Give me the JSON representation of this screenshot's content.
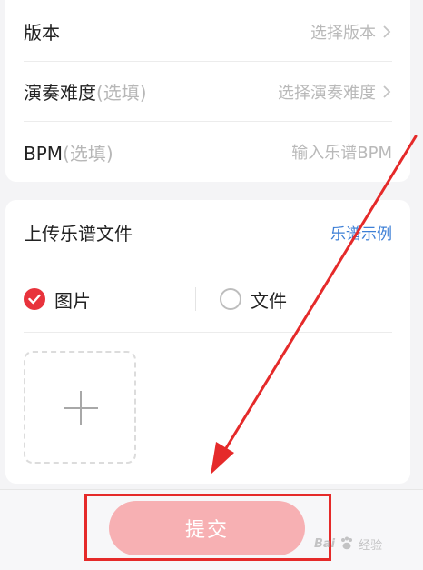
{
  "form": {
    "rows": [
      {
        "label": "版本",
        "optional": "",
        "value": "选择版本",
        "chevron": "chevron-right-icon"
      },
      {
        "label": "演奏难度",
        "optional": "(选填)",
        "value": "选择演奏难度",
        "chevron": "chevron-right-icon"
      },
      {
        "label": "BPM",
        "optional": "(选填)",
        "value": "输入乐谱BPM"
      }
    ]
  },
  "upload": {
    "title": "上传乐谱文件",
    "example_link": "乐谱示例",
    "types": [
      {
        "label": "图片",
        "checked": true
      },
      {
        "label": "文件",
        "checked": false
      }
    ],
    "add_icon": "plus-icon"
  },
  "footer": {
    "submit_label": "提交"
  },
  "watermark": {
    "brand": "Bai",
    "brand_suffix": "经验",
    "icon": "paw-icon"
  },
  "colors": {
    "accent_red": "#e8333c",
    "submit_bg": "#f7b0b3",
    "link_blue": "#3d7fd6",
    "annotation_red": "#e52a2a"
  }
}
